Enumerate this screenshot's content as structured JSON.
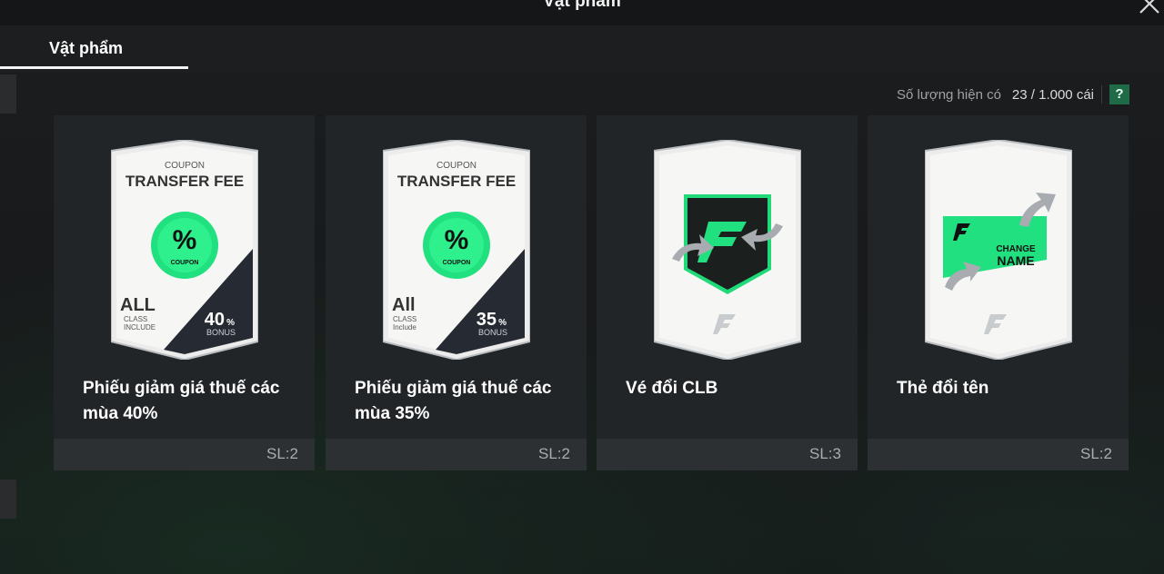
{
  "window": {
    "title": "Vật phẩm"
  },
  "tabs": [
    {
      "label": "Vật phẩm",
      "active": true
    }
  ],
  "inventory": {
    "count_label": "Số lượng hiện có",
    "count_value": "23 / 1.000 cái",
    "help_label": "?"
  },
  "accent_color": "#1fe07f",
  "items": [
    {
      "name": "Phiếu giảm giá thuế các mùa 40%",
      "quantity": "SL:2",
      "icon": "transfer-fee-coupon-icon",
      "art": {
        "coupon": "COUPON",
        "title": "TRANSFER FEE",
        "badge": "COUPON",
        "class_main": "ALL",
        "class_line1": "CLASS",
        "class_line2": "INCLUDE",
        "percent": "40",
        "percent_unit": "%",
        "bonus": "BONUS"
      }
    },
    {
      "name": "Phiếu giảm giá thuế các mùa 35%",
      "quantity": "SL:2",
      "icon": "transfer-fee-coupon-icon",
      "art": {
        "coupon": "COUPON",
        "title": "TRANSFER FEE",
        "badge": "COUPON",
        "class_main": "All",
        "class_line1": "CLASS",
        "class_line2": "Include",
        "percent": "35",
        "percent_unit": "%",
        "bonus": "BONUS"
      }
    },
    {
      "name": "Vé đổi CLB",
      "quantity": "SL:3",
      "icon": "club-change-ticket-icon"
    },
    {
      "name": "Thẻ đổi tên",
      "quantity": "SL:2",
      "icon": "name-change-card-icon",
      "art": {
        "line1": "CHANGE",
        "line2": "NAME"
      }
    }
  ]
}
